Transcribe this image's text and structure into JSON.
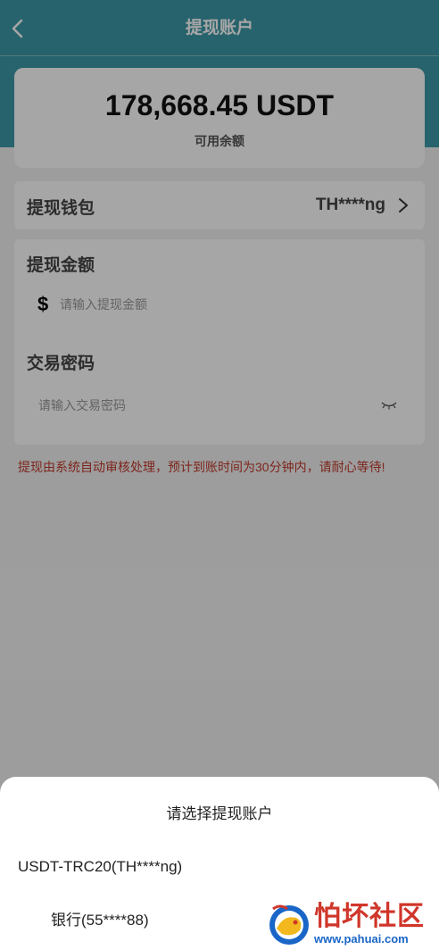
{
  "header": {
    "title": "提现账户"
  },
  "balance": {
    "amount": "178,668.45 USDT",
    "label": "可用余额"
  },
  "wallet": {
    "label": "提现钱包",
    "value": "TH****ng"
  },
  "amount": {
    "label": "提现金额",
    "currency_symbol": "$",
    "placeholder": "请输入提现金额"
  },
  "password": {
    "label": "交易密码",
    "placeholder": "请输入交易密码"
  },
  "notice": "提现由系统自动审核处理，预计到账时间为30分钟内，请耐心等待!",
  "sheet": {
    "title": "请选择提现账户",
    "options": [
      "USDT-TRC20(TH****ng)",
      "银行(55****88)"
    ]
  },
  "watermark": {
    "text": "怕坏社区",
    "url": "www.pahuai.com"
  },
  "colors": {
    "header": "#3d98a7",
    "notice": "#c0392b",
    "watermark_red": "#d0362a",
    "watermark_blue": "#1a66c8"
  }
}
